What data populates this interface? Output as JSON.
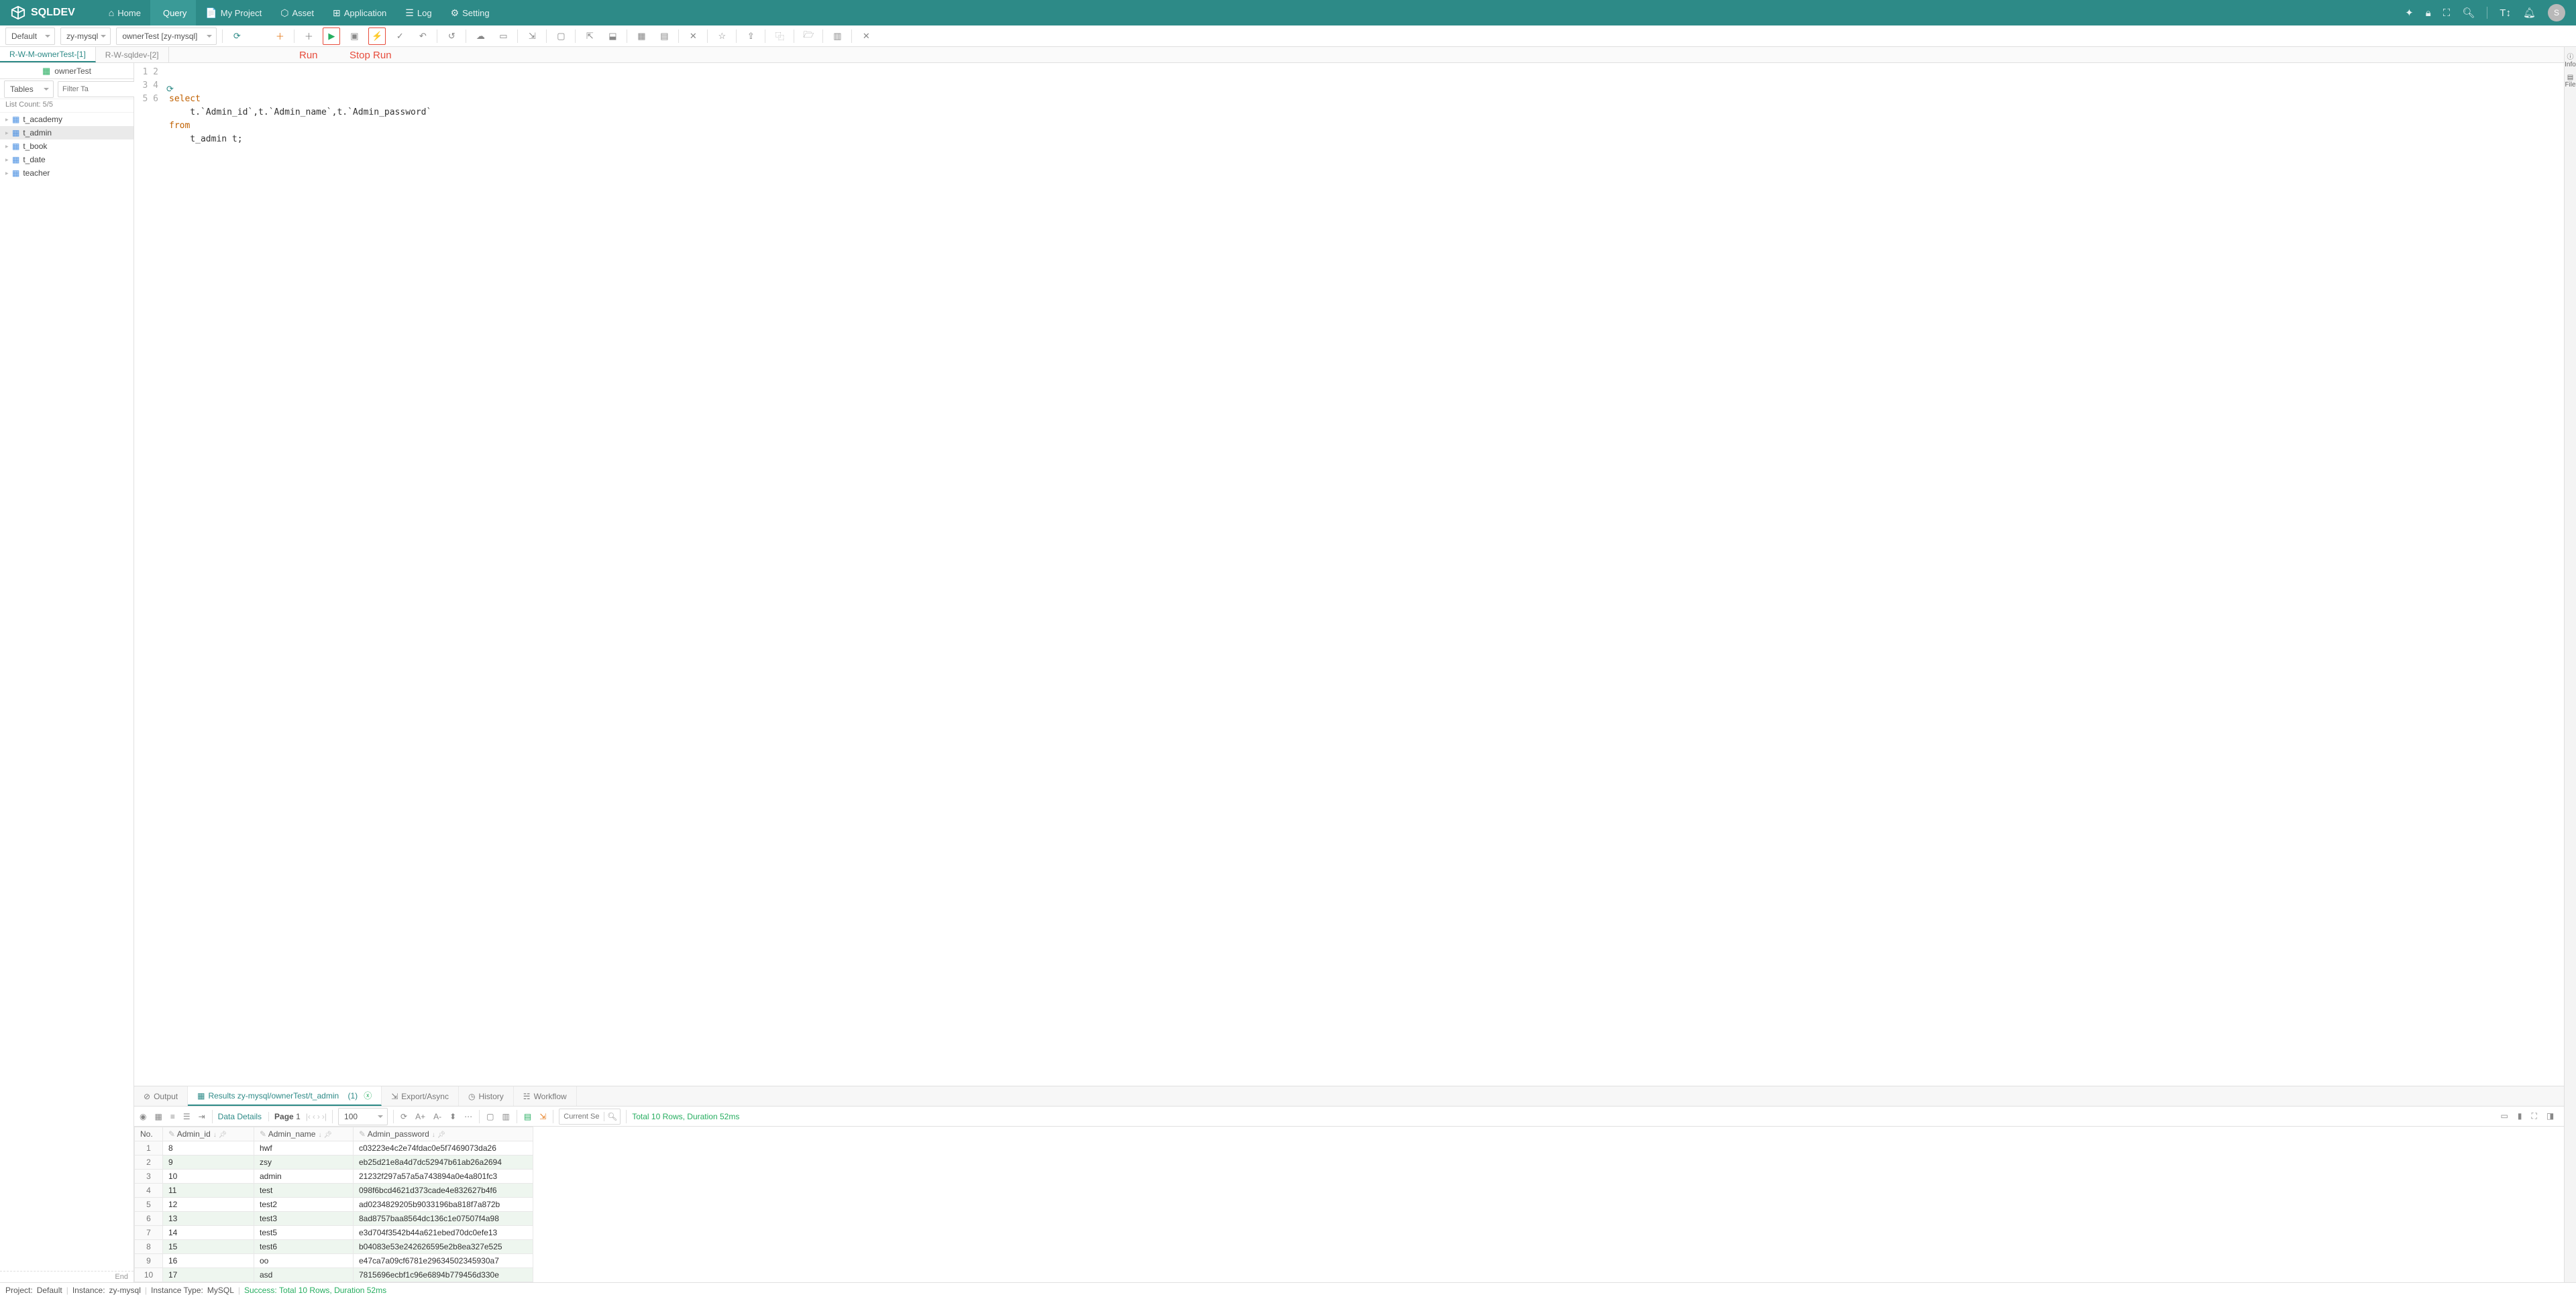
{
  "brand": "SQLDEV",
  "nav": [
    {
      "icon": "⌂",
      "label": "Home"
    },
    {
      "icon": "</>",
      "label": "Query",
      "active": true
    },
    {
      "icon": "📄",
      "label": "My Project"
    },
    {
      "icon": "⬡",
      "label": "Asset"
    },
    {
      "icon": "⊞",
      "label": "Application"
    },
    {
      "icon": "☰",
      "label": "Log"
    },
    {
      "icon": "⚙",
      "label": "Setting"
    }
  ],
  "selects": {
    "a": "Default",
    "b": "zy-mysql",
    "c": "ownerTest [zy-mysql]"
  },
  "annotations": {
    "run": "Run",
    "stop": "Stop Run"
  },
  "file_tabs": [
    {
      "label": "R-W-M-ownerTest-[1]",
      "active": true
    },
    {
      "label": "R-W-sqldev-[2]"
    }
  ],
  "side": {
    "header": "ownerTest",
    "tablesLabel": "Tables",
    "filterPlaceholder": "Filter Ta",
    "countLabel": "List Count:  5/5",
    "items": [
      "t_academy",
      "t_admin",
      "t_book",
      "t_date",
      "teacher"
    ],
    "selected": "t_admin",
    "end": "End"
  },
  "sql": {
    "lines": [
      "1",
      "2",
      "3",
      "4",
      "5",
      "6"
    ],
    "text": {
      "l1": "",
      "l2_kw": "select",
      "l3": "    t.`Admin_id`,t.`Admin_name`,t.`Admin_password`",
      "l4_kw": "from",
      "l5": "    t_admin t;",
      "l6": ""
    }
  },
  "result_tabs": {
    "output": "Output",
    "results": "Results zy-mysql/ownerTest/t_admin",
    "results_count": "(1)",
    "export": "Export/Async",
    "history": "History",
    "workflow": "Workflow"
  },
  "result_toolbar": {
    "dataDetails": "Data Details",
    "page": "Page",
    "pageNo": "1",
    "rowsPerPage": "100",
    "fontA": "A+",
    "fontB": "A-",
    "searchPlaceholder": "Current Se",
    "summary": "Total 10 Rows, Duration 52ms"
  },
  "columns": {
    "no": "No.",
    "c1": "Admin_id",
    "c2": "Admin_name",
    "c3": "Admin_password"
  },
  "rows": [
    {
      "n": "1",
      "a": "8",
      "b": "hwf",
      "c": "c03223e4c2e74fdac0e5f7469073da26"
    },
    {
      "n": "2",
      "a": "9",
      "b": "zsy",
      "c": "eb25d21e8a4d7dc52947b61ab26a2694"
    },
    {
      "n": "3",
      "a": "10",
      "b": "admin",
      "c": "21232f297a57a5a743894a0e4a801fc3"
    },
    {
      "n": "4",
      "a": "11",
      "b": "test",
      "c": "098f6bcd4621d373cade4e832627b4f6"
    },
    {
      "n": "5",
      "a": "12",
      "b": "test2",
      "c": "ad0234829205b9033196ba818f7a872b"
    },
    {
      "n": "6",
      "a": "13",
      "b": "test3",
      "c": "8ad8757baa8564dc136c1e07507f4a98"
    },
    {
      "n": "7",
      "a": "14",
      "b": "test5",
      "c": "e3d704f3542b44a621ebed70dc0efe13"
    },
    {
      "n": "8",
      "a": "15",
      "b": "test6",
      "c": "b04083e53e242626595e2b8ea327e525"
    },
    {
      "n": "9",
      "a": "16",
      "b": "oo",
      "c": "e47ca7a09cf6781e2963450234593 0a7"
    },
    {
      "n": "10",
      "a": "17",
      "b": "asd",
      "c": "7815696ecbf1c96e6894b779456d330e"
    }
  ],
  "status": {
    "projectLabel": "Project:",
    "project": "Default",
    "instanceLabel": "Instance:",
    "instance": "zy-mysql",
    "typeLabel": "Instance Type:",
    "type": "MySQL",
    "successLabel": "Success:",
    "successMsg": "Total 10 Rows, Duration 52ms"
  },
  "rail": {
    "info": "Info",
    "file": "File"
  },
  "avatar": "S"
}
